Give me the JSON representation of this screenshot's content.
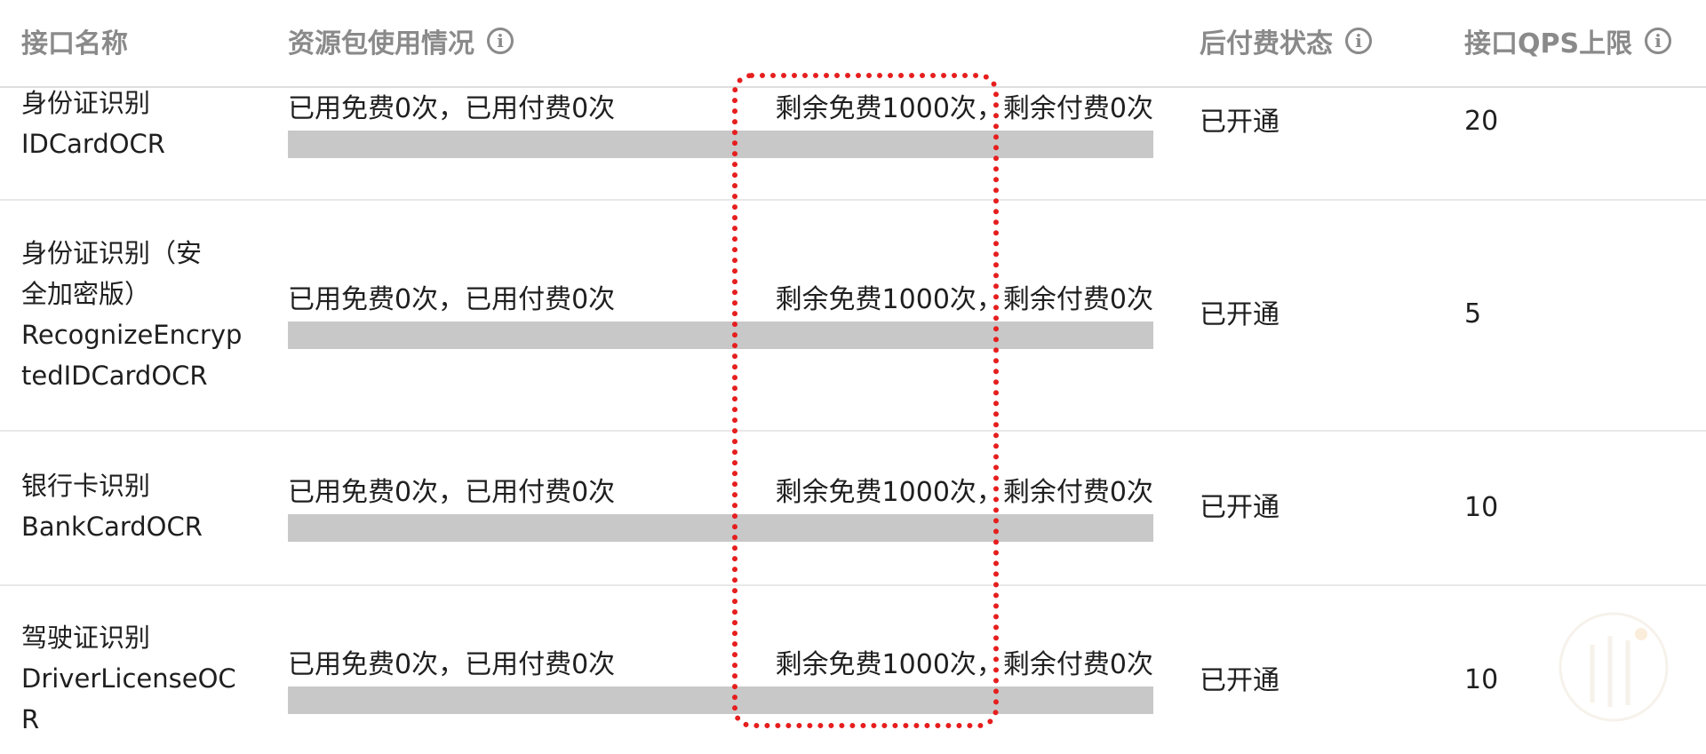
{
  "table": {
    "columns": [
      {
        "key": "name",
        "label": "接口名称",
        "has_info": false
      },
      {
        "key": "usage",
        "label": "资源包使用情况",
        "has_info": true
      },
      {
        "key": "status",
        "label": "后付费状态",
        "has_info": true
      },
      {
        "key": "qps",
        "label": "接口QPS上限",
        "has_info": true
      }
    ],
    "rows": [
      {
        "name_lines": [
          "身份证识别",
          "IDCardOCR"
        ],
        "used_text": "已用免费0次，已用付费0次",
        "remain_text": "剩余免费1000次，剩余付费0次",
        "used_fraction": 0,
        "status": "已开通",
        "qps": "20"
      },
      {
        "name_lines": [
          "身份证识别（安",
          "全加密版）",
          "RecognizeEncryp",
          "tedIDCardOCR"
        ],
        "used_text": "已用免费0次，已用付费0次",
        "remain_text": "剩余免费1000次，剩余付费0次",
        "used_fraction": 0,
        "status": "已开通",
        "qps": "5"
      },
      {
        "name_lines": [
          "银行卡识别",
          "BankCardOCR"
        ],
        "used_text": "已用免费0次，已用付费0次",
        "remain_text": "剩余免费1000次，剩余付费0次",
        "used_fraction": 0,
        "status": "已开通",
        "qps": "10"
      },
      {
        "name_lines": [
          "驾驶证识别",
          "DriverLicenseOC",
          "R"
        ],
        "used_text": "已用免费0次，已用付费0次",
        "remain_text": "剩余免费1000次，剩余付费0次",
        "used_fraction": 0,
        "status": "已开通",
        "qps": "10"
      }
    ]
  },
  "icons": {
    "info": "info-circle-icon"
  },
  "colors": {
    "header_text": "#8a8a8a",
    "progress_track": "#c8c8c8",
    "highlight_annotation": "#e61e1e"
  }
}
